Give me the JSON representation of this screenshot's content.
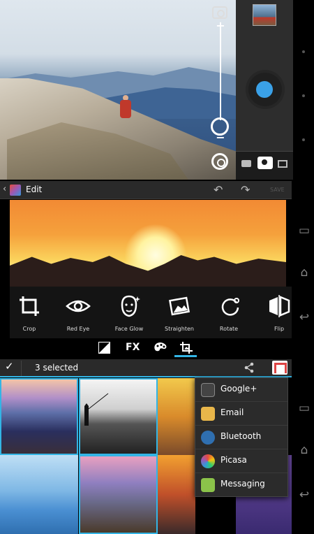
{
  "camera": {
    "zoom_plus": "+",
    "zoom_minus": "−"
  },
  "editor": {
    "back_glyph": "‹",
    "title": "Edit",
    "undo_glyph": "↶",
    "redo_glyph": "↷",
    "save_label": "SAVE",
    "tools": [
      {
        "label": "Crop",
        "icon": "crop-icon"
      },
      {
        "label": "Red Eye",
        "icon": "eye-icon"
      },
      {
        "label": "Face Glow",
        "icon": "face-icon"
      },
      {
        "label": "Straighten",
        "icon": "straighten-icon"
      },
      {
        "label": "Rotate",
        "icon": "rotate-icon"
      },
      {
        "label": "Flip",
        "icon": "flip-icon"
      }
    ],
    "tabs": [
      {
        "label": "◩",
        "icon": "exposure-icon"
      },
      {
        "label": "FX",
        "icon": "fx-icon"
      },
      {
        "label": "🎨",
        "icon": "palette-icon"
      },
      {
        "label": "⛶",
        "icon": "geometry-icon"
      }
    ]
  },
  "gallery": {
    "check_glyph": "✓",
    "selected_label": "3 selected",
    "share_glyph": "≺",
    "share_options": [
      {
        "label": "Google+",
        "icon": "google-plus-icon",
        "color": "#444444"
      },
      {
        "label": "Email",
        "icon": "email-icon",
        "color": "#e8b64a"
      },
      {
        "label": "Bluetooth",
        "icon": "bluetooth-icon",
        "color": "#2f6fb0"
      },
      {
        "label": "Picasa",
        "icon": "picasa-icon",
        "color": "#4a9a3a"
      },
      {
        "label": "Messaging",
        "icon": "messaging-icon",
        "color": "#8bc34a"
      }
    ]
  },
  "nav": {
    "recents_glyph": "▭",
    "home_glyph": "⌂",
    "back_glyph": "↩"
  },
  "colors": {
    "accent": "#33b5e5",
    "shutter": "#3aa1e8"
  }
}
